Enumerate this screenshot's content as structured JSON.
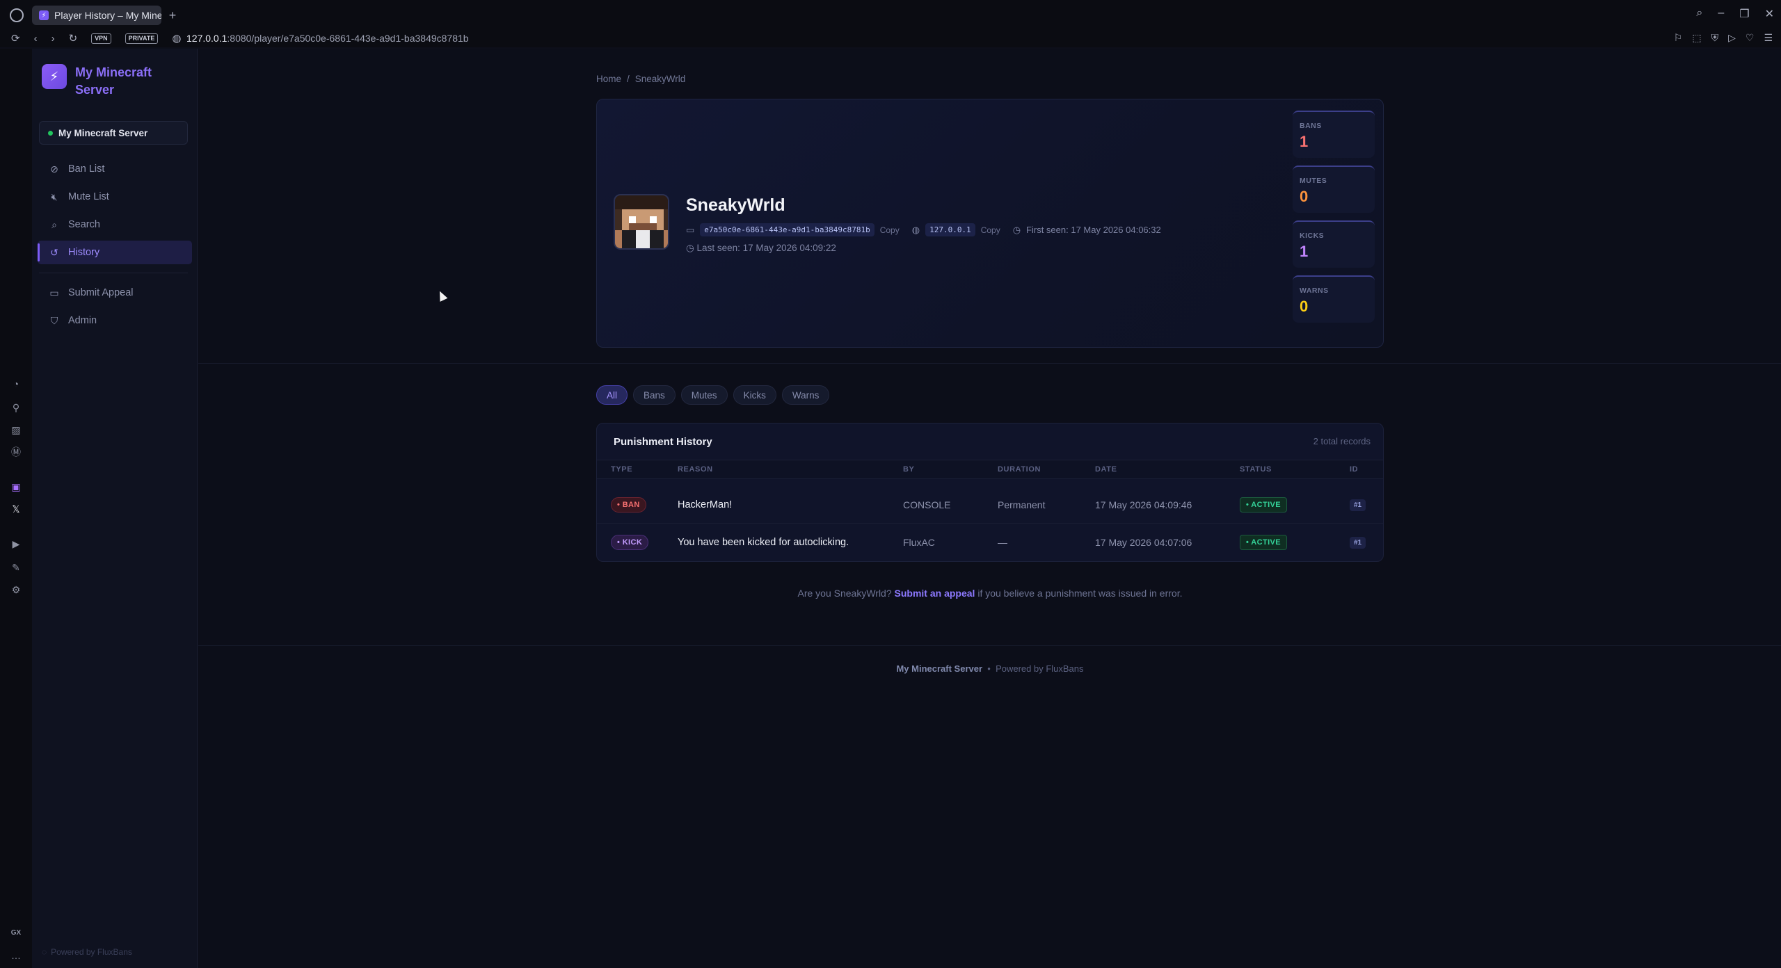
{
  "browser": {
    "tab_title": "Player History – My Minec",
    "url_host": "127.0.0.1",
    "url_path": ":8080/player/e7a50c0e-6861-443e-a9d1-ba3849c8781b",
    "vpn_label": "VPN",
    "private_label": "PRIVATE"
  },
  "sidebar": {
    "brand": "My Minecraft Server",
    "server": "My Minecraft Server",
    "items": [
      {
        "label": "Ban List",
        "icon": "ban-icon"
      },
      {
        "label": "Mute List",
        "icon": "mute-icon"
      },
      {
        "label": "Search",
        "icon": "search-icon"
      },
      {
        "label": "History",
        "icon": "history-icon",
        "active": true
      },
      {
        "label": "Submit Appeal",
        "icon": "chat-icon"
      },
      {
        "label": "Admin",
        "icon": "shield-icon"
      }
    ],
    "footer": "Powered by FluxBans"
  },
  "breadcrumb": {
    "home": "Home",
    "sep": "/",
    "current": "SneakyWrld"
  },
  "player": {
    "name": "SneakyWrld",
    "uuid": "e7a50c0e-6861-443e-a9d1-ba3849c8781b",
    "ip": "127.0.0.1",
    "copy_label": "Copy",
    "first_seen": "First seen: 17 May 2026 04:06:32",
    "last_seen": "Last seen: 17 May 2026 04:09:22"
  },
  "stats": [
    {
      "label": "BANS",
      "value": "1",
      "color": "#f87171"
    },
    {
      "label": "MUTES",
      "value": "0",
      "color": "#fb923c"
    },
    {
      "label": "KICKS",
      "value": "1",
      "color": "#c084fc"
    },
    {
      "label": "WARNS",
      "value": "0",
      "color": "#facc15"
    }
  ],
  "filters": [
    "All",
    "Bans",
    "Mutes",
    "Kicks",
    "Warns"
  ],
  "table": {
    "title": "Punishment History",
    "count": "2 total records",
    "columns": [
      "TYPE",
      "REASON",
      "BY",
      "DURATION",
      "DATE",
      "STATUS",
      "ID"
    ],
    "rows": [
      {
        "type": "• BAN",
        "reason": "HackerMan!",
        "by": "CONSOLE",
        "duration": "Permanent",
        "date": "17 May 2026 04:09:46",
        "status": "• ACTIVE",
        "id": "#1"
      },
      {
        "type": "• KICK",
        "reason": "You have been kicked for autoclicking.",
        "by": "FluxAC",
        "duration": "—",
        "date": "17 May 2026 04:07:06",
        "status": "• ACTIVE",
        "id": "#1"
      }
    ]
  },
  "appeal": {
    "prefix": "Are you SneakyWrld?",
    "link": "Submit an appeal",
    "suffix": "if you believe a punishment was issued in error."
  },
  "footer": {
    "brand": "My Minecraft Server",
    "dot": "•",
    "powered": "Powered by FluxBans"
  }
}
